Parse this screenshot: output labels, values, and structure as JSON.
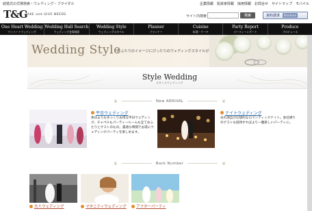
{
  "header": {
    "tagline": "結婚式の式場検索・ウェディング・ブライダル",
    "utility_links": [
      "企業情報",
      "投資家情報",
      "採用情報",
      "お問合せ",
      "サイトマップ",
      "モバイル"
    ],
    "logo": "T&G",
    "logo_sub": "TAKE and GIVE NEEDS",
    "search_label": "サイト内検索",
    "search_placeholder": "",
    "search_button": "検索",
    "request_button": "資料請求",
    "request_button_en": "Brochure"
  },
  "nav": [
    {
      "en": "One Heart Wedding",
      "jp": "ワンハートウェディング"
    },
    {
      "en": "Wedding Hall Search",
      "jp": "ウェディング会場検索"
    },
    {
      "en": "Wedding Style",
      "jp": "ウェディングスタイル"
    },
    {
      "en": "Planner",
      "jp": "プランナー"
    },
    {
      "en": "Cuisine",
      "jp": "料理・ケーキ"
    },
    {
      "en": "Party Report",
      "jp": "パーティーレポート"
    },
    {
      "en": "Produce",
      "jp": "プロデュース"
    }
  ],
  "hero": {
    "title": "Wedding Style",
    "text": "おふたりのイメージにぴったりのウェディングスタイルが見つかる。"
  },
  "style_band": {
    "title": "Style Wedding",
    "subtitle": "スタイルウェディング"
  },
  "new_arrival": {
    "label": "New ARRIVAL",
    "cards": [
      {
        "title": "平日ウェディング",
        "text": "休日よりもゆっくりお得な平日ウェディング。チャペルもパーティールームも全ておふたりとゲストのもの。最適な時間でお得にウェディングパーティを楽しめます。"
      },
      {
        "title": "ナイトウェディング",
        "text": "光の演出が幻想的なロマンティックナイト。会社帰りのゲストも招待すればより一層楽しいパーティに。"
      }
    ]
  },
  "back_number": {
    "label": "Back Number",
    "items": [
      {
        "title": "大人ウェディング"
      },
      {
        "title": "マタニティウェディング"
      },
      {
        "title": "アフターパーティ"
      }
    ]
  },
  "colors": {
    "nav_bg": "#111111",
    "link_blue": "#2e6db0",
    "back_link": "#b04a2e",
    "bullet": "#e38b2c",
    "hero_text": "#8a7a63"
  }
}
